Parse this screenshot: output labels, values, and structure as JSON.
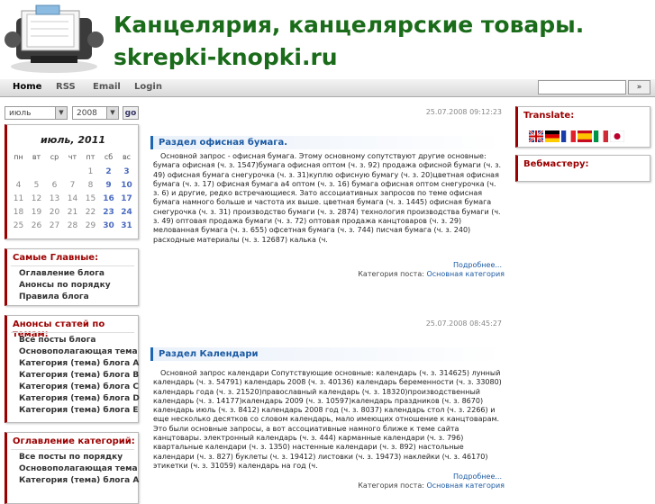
{
  "header": {
    "title": "Канцелярия, канцелярские товары. skrepki-knopki.ru"
  },
  "nav": {
    "items": [
      "Home",
      "RSS",
      "Email",
      "Login"
    ],
    "search_button": "»"
  },
  "archive": {
    "month": "июль",
    "year": "2008",
    "go": "go"
  },
  "calendar": {
    "title": "июль, 2011",
    "weekdays": [
      "пн",
      "вт",
      "ср",
      "чт",
      "пт",
      "сб",
      "вс"
    ],
    "rows": [
      [
        "",
        "",
        "",
        "",
        "1",
        "2",
        "3"
      ],
      [
        "4",
        "5",
        "6",
        "7",
        "8",
        "9",
        "10"
      ],
      [
        "11",
        "12",
        "13",
        "14",
        "15",
        "16",
        "17"
      ],
      [
        "18",
        "19",
        "20",
        "21",
        "22",
        "23",
        "24"
      ],
      [
        "25",
        "26",
        "27",
        "28",
        "29",
        "30",
        "31"
      ]
    ]
  },
  "main_box": {
    "title": "Самые Главные:",
    "links": [
      "Оглавление блога",
      "Анонсы по порядку",
      "Правила блога"
    ]
  },
  "topics_box": {
    "title": "Анонсы статей по темам:",
    "links": [
      "Все посты блога",
      "Основополагающая тема",
      "Категория (тема) блога A",
      "Категория (тема) блога B",
      "Категория (тема) блога C",
      "Категория (тема) блога D",
      "Категория (тема) блога E"
    ]
  },
  "categories_box": {
    "title": "Оглавление категорий:",
    "links": [
      "Все посты по порядку",
      "Основополагающая тема",
      "Категория (тема) блога A"
    ]
  },
  "posts": [
    {
      "date": "25.07.2008 09:12:23",
      "title": "Раздел офисная бумага.",
      "body": "Основной запрос - офисная бумага. Этому основному сопутствуют другие основные: бумага офисная (ч. з. 1547)бумага офисная оптом (ч. з. 92) продажа офисной бумаги (ч. з. 49) офисная бумага снегурочка (ч. з. 31)куплю офисную бумагу (ч. з. 20)цветная офисная бумага (ч. з. 17) офисная бумага а4 оптом (ч. з. 16) бумага офисная оптом снегурочка (ч. з. 6) и другие, редко встречающиеся. Зато ассоциативных запросов по теме офисная бумага намного больше и частота их выше. цветная бумага (ч. з. 1445) офисная бумага снегурочка (ч. з. 31) производство бумаги (ч. з. 2874) технология производства бумаги (ч. з. 49) оптовая продажа бумаги (ч. з. 72) оптовая продажа канцтоваров (ч. з. 29) мелованная бумага (ч. з. 655) офсетная бумага (ч. з. 744) писчая бумага (ч. з. 240) расходные материалы (ч. з. 12687) калька (ч.",
      "more": "Подробнее...",
      "category_label": "Категория поста:",
      "category": "Основная категория"
    },
    {
      "date": "25.07.2008 08:45:27",
      "title": "Раздел Календари",
      "body": "Основной запрос календари Сопутствующие основные: календарь (ч. з. 314625) лунный календарь (ч. з. 54791) календарь 2008 (ч. з. 40136) календарь беременности (ч. з. 33080) календарь года (ч. з. 21520)православный календарь (ч. з. 18320)производственный календарь (ч. з. 14177)календарь 2009 (ч. з. 10597)календарь праздников (ч. з. 8670) календарь июль (ч. з. 8412) календарь 2008 год (ч. з. 8037) календарь стол (ч. з. 2266) и еще несколько десятков со словом календарь, мало имеющих отношение к канцтоварам. Это были основные запросы, а вот ассоциативные намного ближе к теме сайта канцтовары. электронный календарь (ч. з. 444) карманные календари (ч. з. 796) квартальные календари (ч. з. 1350) настенные календари (ч. з. 892) настольные календари (ч. з. 827) буклеты (ч. з. 19412) листовки (ч. з. 19473) наклейки (ч. з. 46170) этикетки (ч. з. 31059) календарь на год (ч.",
      "more": "Подробнее...",
      "category_label": "Категория поста:",
      "category": "Основная категория"
    }
  ],
  "right": {
    "translate_title": "Translate:",
    "webmaster_title": "Вебмастеру:",
    "flags": [
      "uk-flag-icon",
      "de-flag-icon",
      "fr-flag-icon",
      "es-flag-icon",
      "it-flag-icon",
      "jp-flag-icon"
    ]
  }
}
